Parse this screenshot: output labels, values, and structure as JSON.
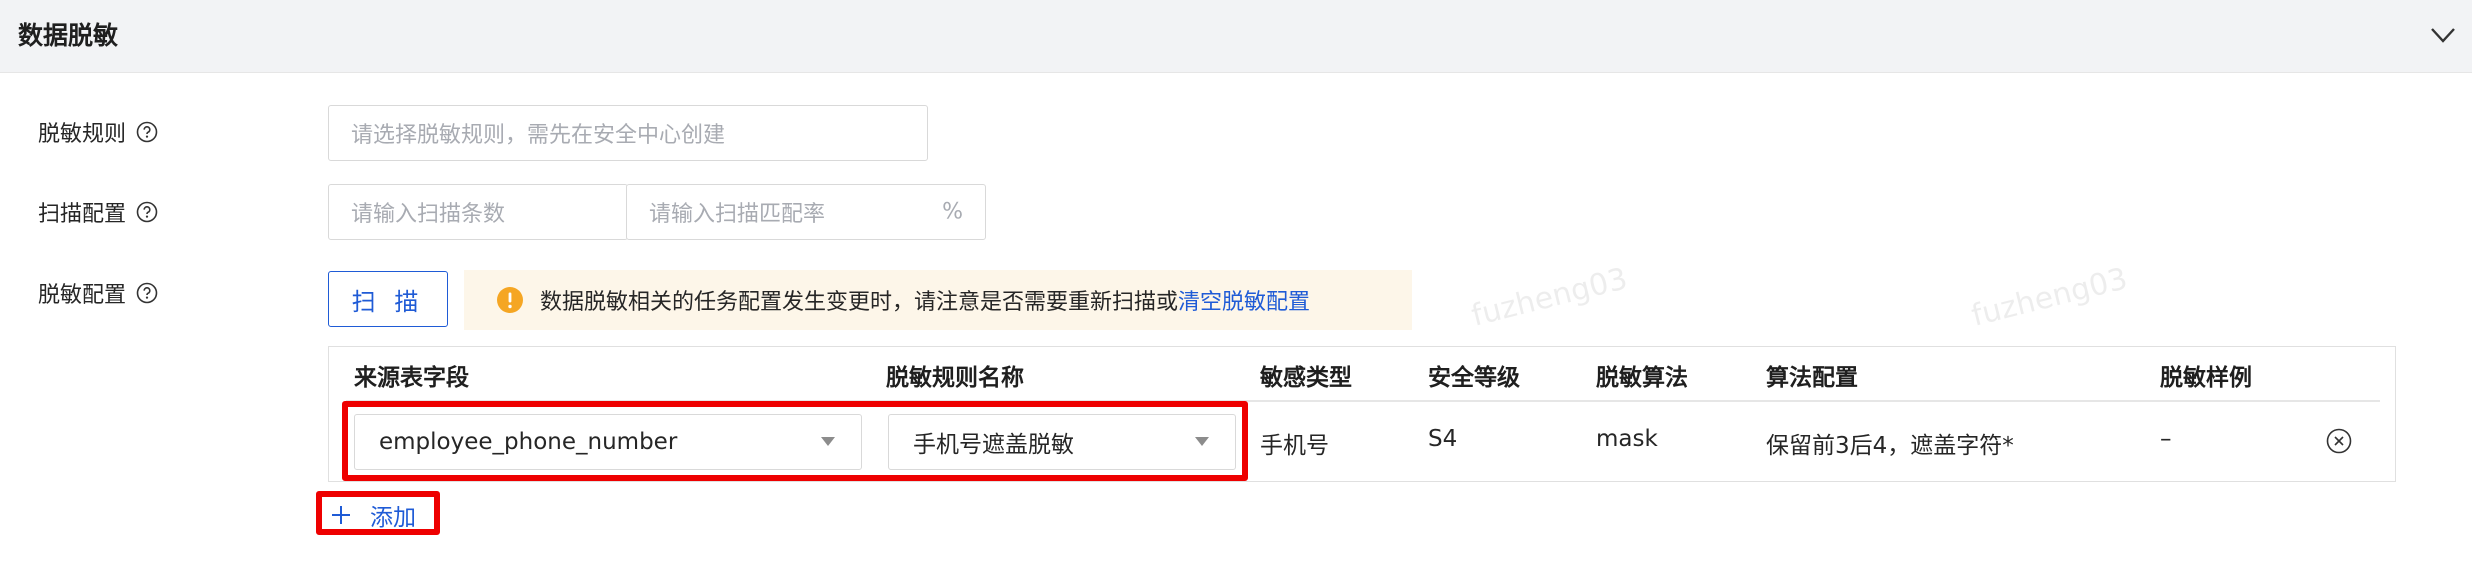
{
  "section": {
    "title": "数据脱敏"
  },
  "form": {
    "rule": {
      "label": "脱敏规则",
      "placeholder": "请选择脱敏规则，需先在安全中心创建"
    },
    "scan_config": {
      "label": "扫描配置",
      "count_placeholder": "请输入扫描条数",
      "rate_placeholder": "请输入扫描匹配率",
      "rate_suffix": "%"
    },
    "mask_config": {
      "label": "脱敏配置",
      "scan_button": "扫 描",
      "alert_text": "数据脱敏相关的任务配置发生变更时，请注意是否需要重新扫描或",
      "alert_link": "清空脱敏配置"
    }
  },
  "table": {
    "columns": [
      "来源表字段",
      "脱敏规则名称",
      "敏感类型",
      "安全等级",
      "脱敏算法",
      "算法配置",
      "脱敏样例"
    ],
    "rows": [
      {
        "source_field": "employee_phone_number",
        "rule_name": "手机号遮盖脱敏",
        "sensitive_type": "手机号",
        "security_level": "S4",
        "algorithm": "mask",
        "algorithm_config": "保留前3后4，遮盖字符*",
        "sample": "–"
      }
    ]
  },
  "add_button": {
    "label": "添加"
  },
  "watermark": "fuzheng03",
  "icons": {
    "collapse": "chevron-down-icon",
    "help": "question-circle-icon",
    "alert": "exclamation-circle-icon",
    "select_caret": "caret-down-icon",
    "remove": "close-circle-icon",
    "add": "plus-icon"
  },
  "colors": {
    "primary": "#1f5bd6",
    "alert_bg": "#fdf6e9",
    "alert_icon": "#f5a623",
    "highlight": "#ee0000",
    "header_bg": "#f2f3f5"
  }
}
